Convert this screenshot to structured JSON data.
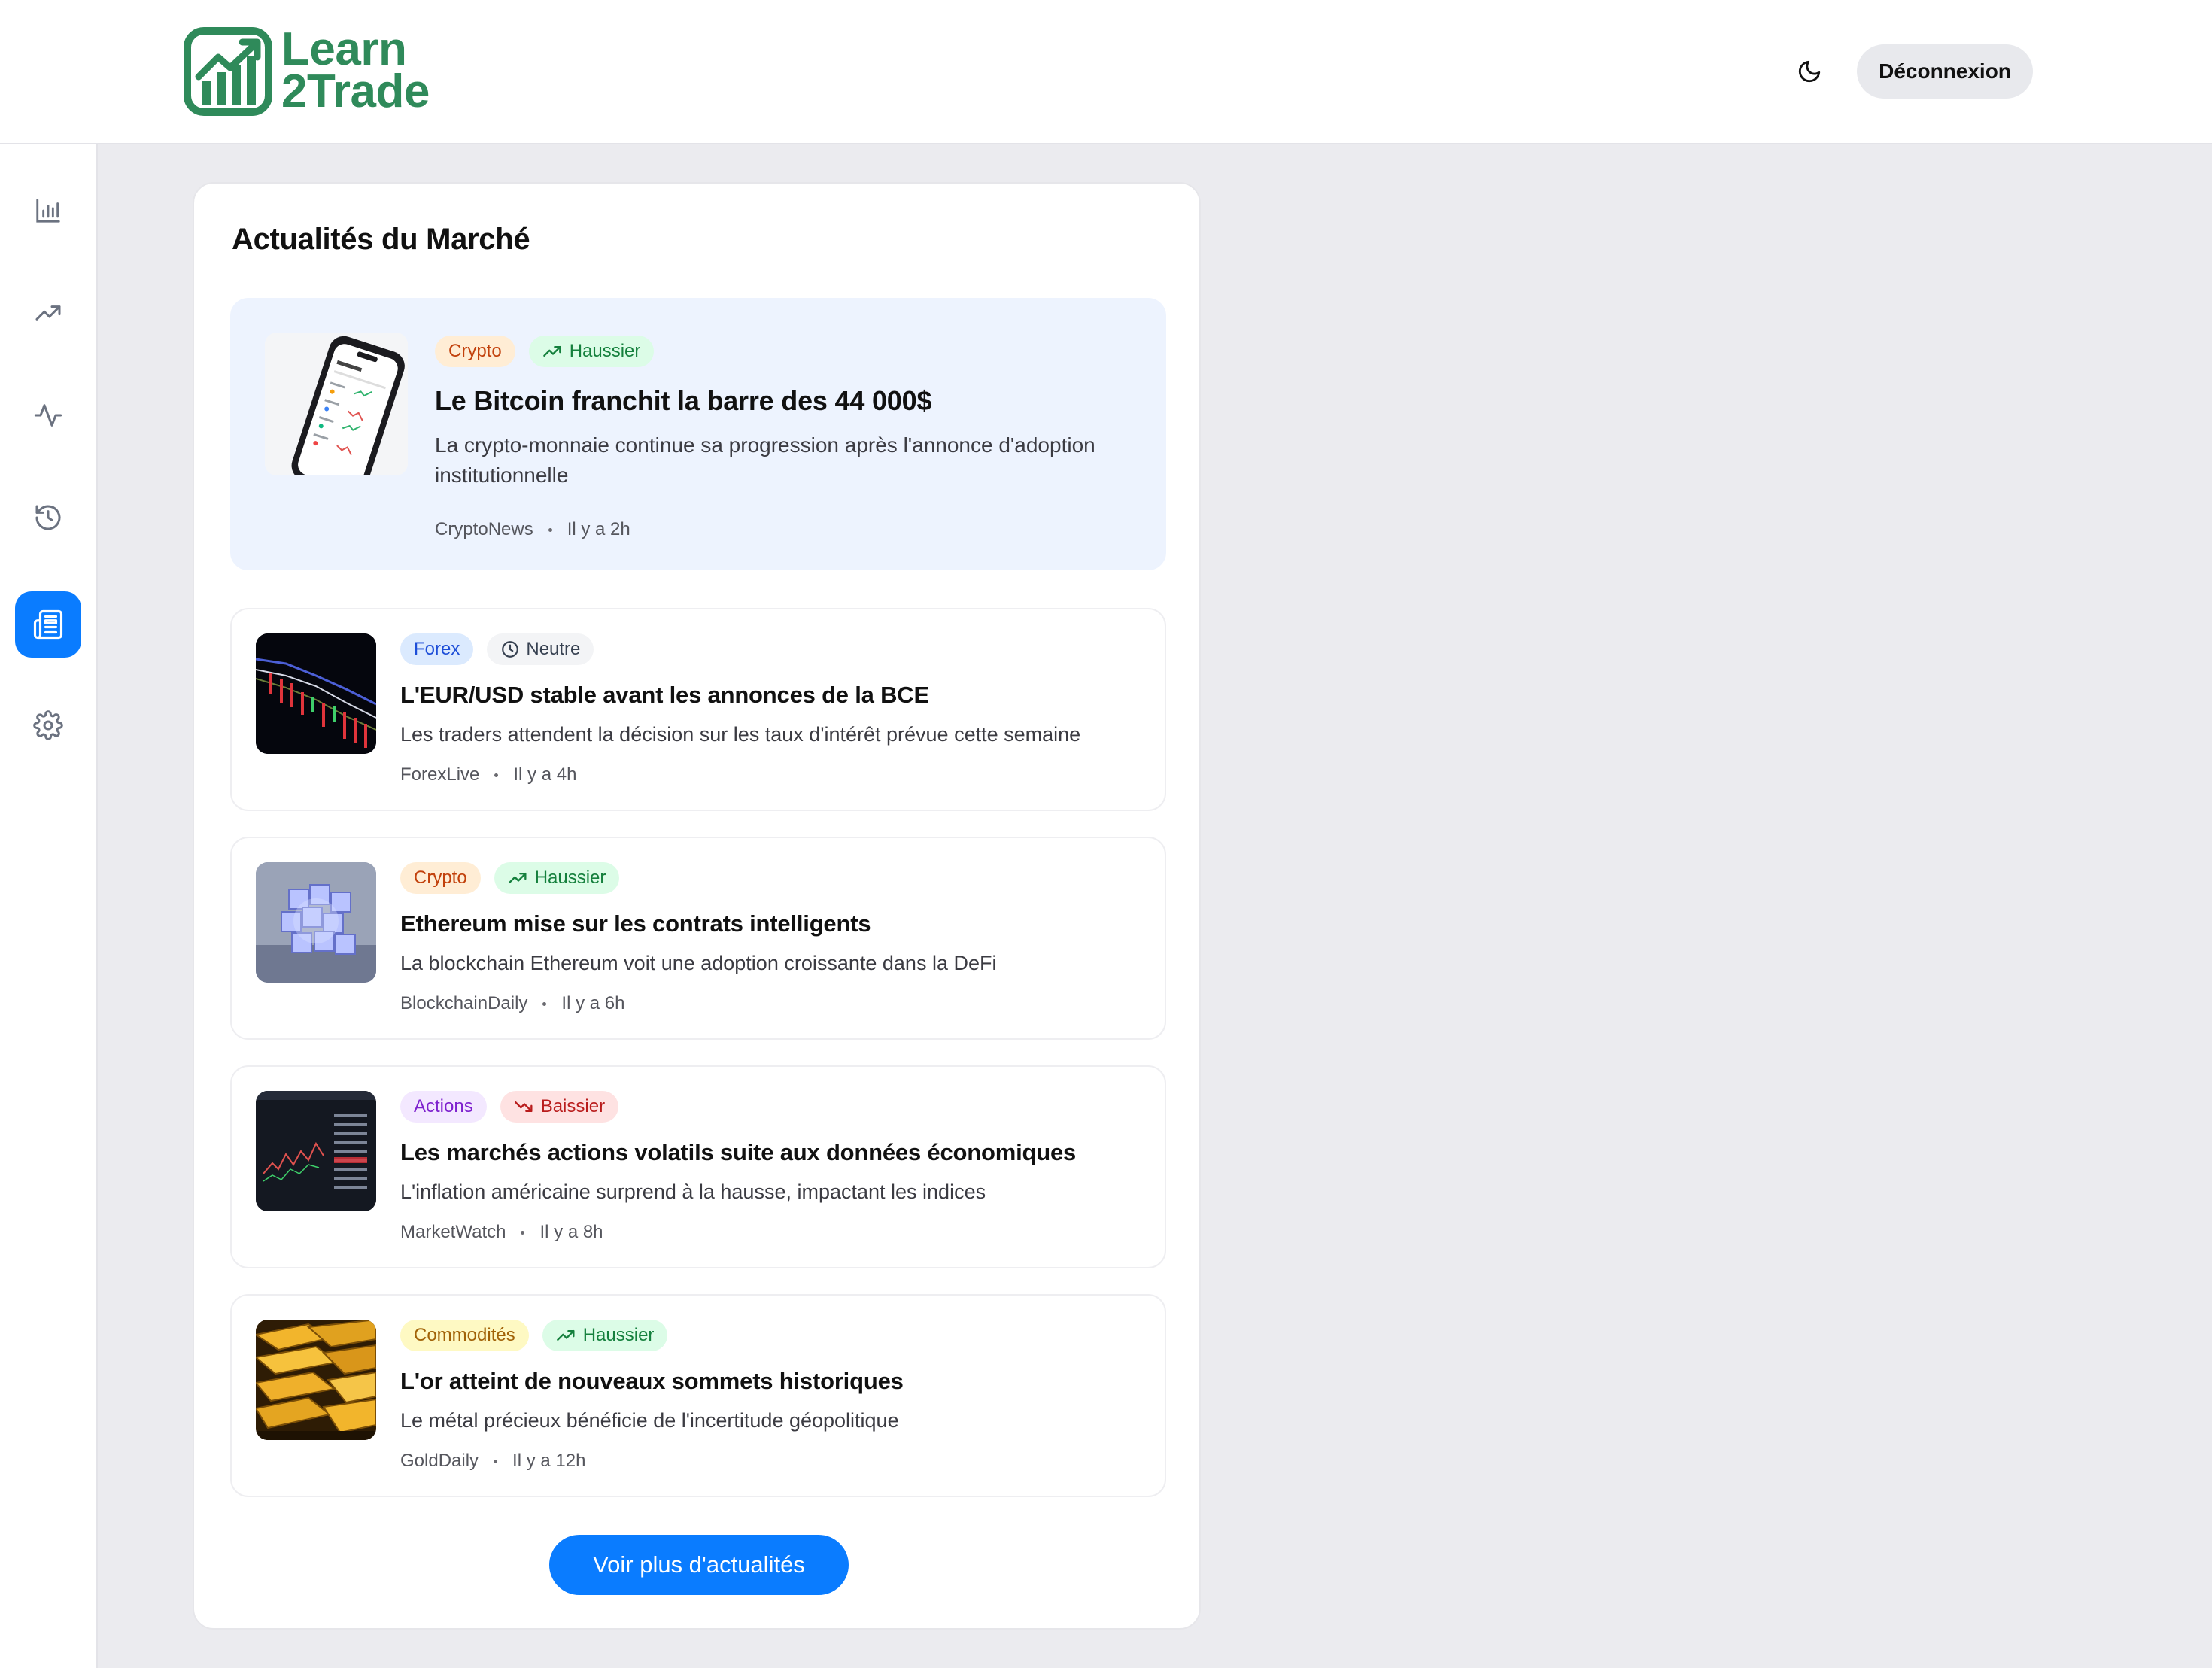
{
  "header": {
    "logo_line1": "Learn",
    "logo_line2": "2Trade",
    "theme_icon": "moon-icon",
    "logout_label": "Déconnexion"
  },
  "sidebar": {
    "items": [
      {
        "icon": "bar-chart-icon",
        "active": false
      },
      {
        "icon": "trending-up-icon",
        "active": false
      },
      {
        "icon": "activity-icon",
        "active": false
      },
      {
        "icon": "history-icon",
        "active": false
      },
      {
        "icon": "newspaper-icon",
        "active": true
      },
      {
        "icon": "gear-icon",
        "active": false
      }
    ]
  },
  "news_panel": {
    "title": "Actualités du Marché",
    "items": [
      {
        "category": "Crypto",
        "sentiment": "Haussier",
        "title": "Le Bitcoin franchit la barre des 44 000$",
        "description": "La crypto-monnaie continue sa progression après l'annonce d'adoption institutionnelle",
        "source": "CryptoNews",
        "time": "Il y a 2h",
        "featured": true
      },
      {
        "category": "Forex",
        "sentiment": "Neutre",
        "title": "L'EUR/USD stable avant les annonces de la BCE",
        "description": "Les traders attendent la décision sur les taux d'intérêt prévue cette semaine",
        "source": "ForexLive",
        "time": "Il y a 4h"
      },
      {
        "category": "Crypto",
        "sentiment": "Haussier",
        "title": "Ethereum mise sur les contrats intelligents",
        "description": "La blockchain Ethereum voit une adoption croissante dans la DeFi",
        "source": "BlockchainDaily",
        "time": "Il y a 6h"
      },
      {
        "category": "Actions",
        "sentiment": "Baissier",
        "title": "Les marchés actions volatils suite aux données économiques",
        "description": "L'inflation américaine surprend à la hausse, impactant les indices",
        "source": "MarketWatch",
        "time": "Il y a 8h"
      },
      {
        "category": "Commodités",
        "sentiment": "Haussier",
        "title": "L'or atteint de nouveaux sommets historiques",
        "description": "Le métal précieux bénéficie de l'incertitude géopolitique",
        "source": "GoldDaily",
        "time": "Il y a 12h"
      }
    ],
    "more_label": "Voir plus d'actualités"
  },
  "colors": {
    "accent": "#0a7cff",
    "brand": "#2f8a5a",
    "bullish_bg": "#dcfce7",
    "bullish_fg": "#15803d",
    "bearish_bg": "#fee2e2",
    "bearish_fg": "#b91c1c",
    "crypto_bg": "#ffedd5",
    "crypto_fg": "#c2410c",
    "forex_bg": "#dbeafe",
    "forex_fg": "#1d4ed8",
    "actions_bg": "#f3e8ff",
    "actions_fg": "#7e22ce",
    "commodities_bg": "#fef9c3",
    "commodities_fg": "#a16207"
  }
}
